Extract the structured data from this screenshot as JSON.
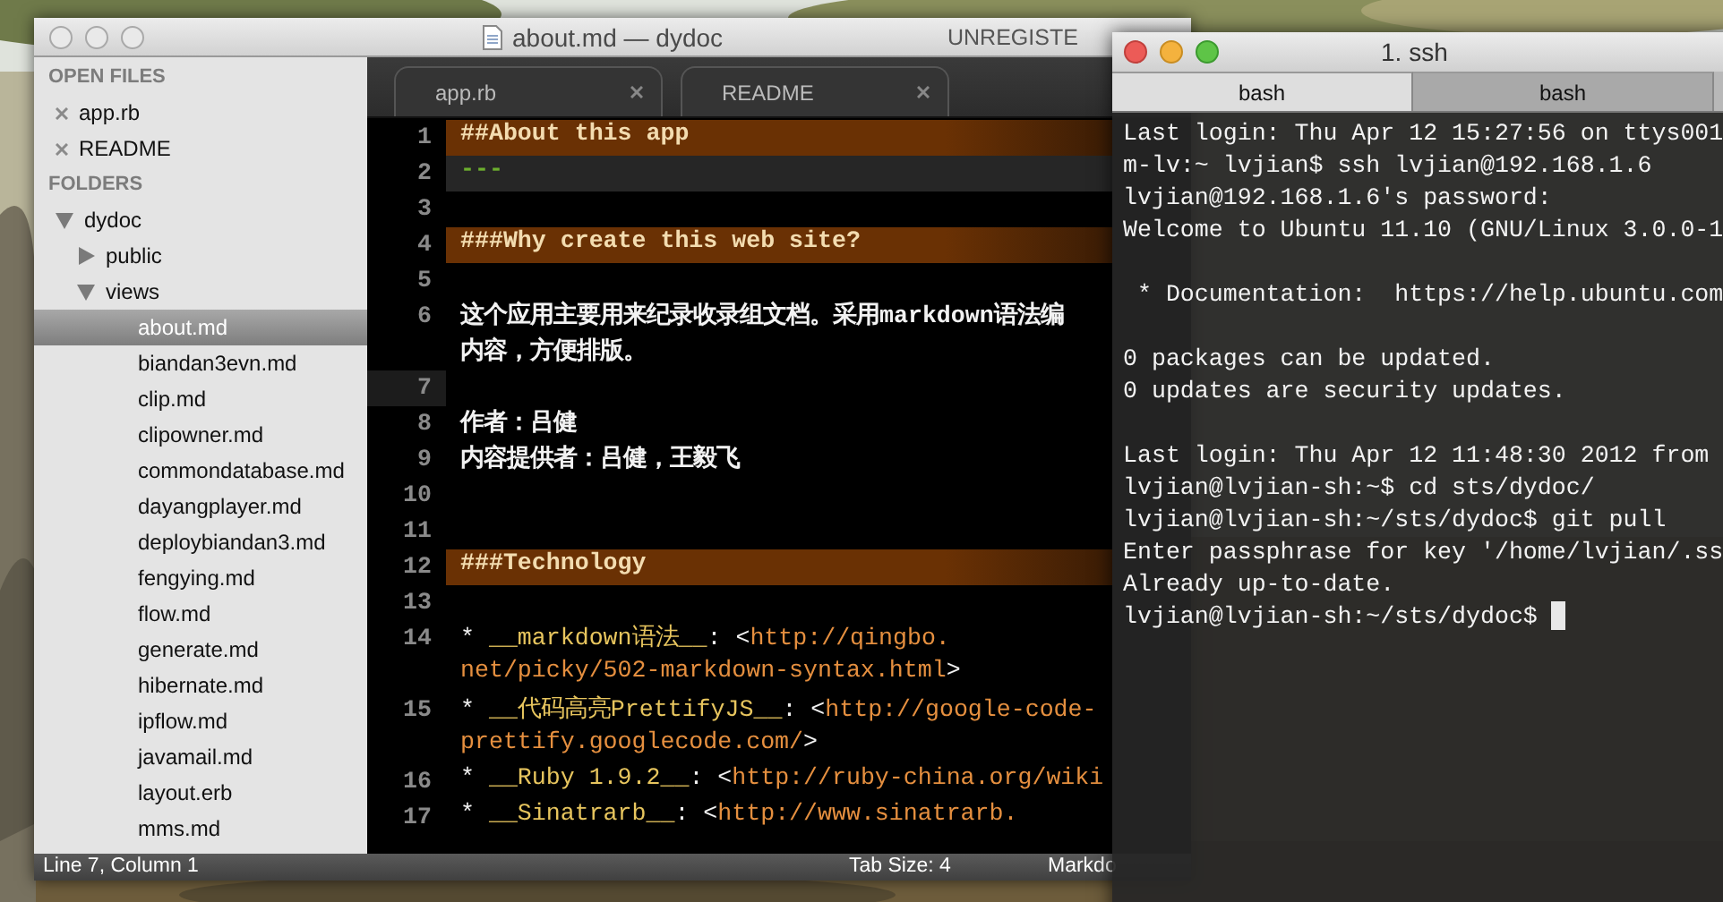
{
  "editor_window": {
    "title": "about.md — dydoc",
    "badge": "UNREGISTE",
    "sidebar": {
      "open_files_header": "OPEN FILES",
      "open_files": [
        {
          "label": "app.rb",
          "selected": false
        },
        {
          "label": "README",
          "selected": false
        }
      ],
      "folders_header": "FOLDERS",
      "tree": [
        {
          "label": "dydoc",
          "kind": "folder",
          "expanded": true,
          "selected": false,
          "children": [
            {
              "label": "public",
              "kind": "folder",
              "expanded": false,
              "selected": false
            },
            {
              "label": "views",
              "kind": "folder",
              "expanded": true,
              "selected": false,
              "children": [
                {
                  "label": "about.md",
                  "kind": "file",
                  "selected": true
                },
                {
                  "label": "biandan3evn.md",
                  "kind": "file",
                  "selected": false
                },
                {
                  "label": "clip.md",
                  "kind": "file",
                  "selected": false
                },
                {
                  "label": "clipowner.md",
                  "kind": "file",
                  "selected": false
                },
                {
                  "label": "commondatabase.md",
                  "kind": "file",
                  "selected": false
                },
                {
                  "label": "dayangplayer.md",
                  "kind": "file",
                  "selected": false
                },
                {
                  "label": "deploybiandan3.md",
                  "kind": "file",
                  "selected": false
                },
                {
                  "label": "fengying.md",
                  "kind": "file",
                  "selected": false
                },
                {
                  "label": "flow.md",
                  "kind": "file",
                  "selected": false
                },
                {
                  "label": "generate.md",
                  "kind": "file",
                  "selected": false
                },
                {
                  "label": "hibernate.md",
                  "kind": "file",
                  "selected": false
                },
                {
                  "label": "ipflow.md",
                  "kind": "file",
                  "selected": false
                },
                {
                  "label": "javamail.md",
                  "kind": "file",
                  "selected": false
                },
                {
                  "label": "layout.erb",
                  "kind": "file",
                  "selected": false
                },
                {
                  "label": "mms.md",
                  "kind": "file",
                  "selected": false
                }
              ]
            }
          ]
        }
      ]
    },
    "tabs": [
      {
        "label": "app.rb",
        "selected": false
      },
      {
        "label": "README",
        "selected": false
      }
    ],
    "lines": [
      {
        "number": "1",
        "kind": "heading",
        "current": false,
        "rows": [
          "##About this app"
        ]
      },
      {
        "number": "2",
        "kind": "rule",
        "current": false,
        "rows": [
          "---"
        ]
      },
      {
        "number": "3",
        "kind": "plain",
        "current": false
      },
      {
        "number": "4",
        "kind": "heading",
        "current": false,
        "rows": [
          "###Why create this web site?"
        ]
      },
      {
        "number": "5",
        "kind": "plain",
        "current": false
      },
      {
        "number": "6",
        "kind": "plain",
        "current": false,
        "rows": [
          "这个应用主要用来纪录收录组文档。采用markdown语法编",
          "内容，方便排版。"
        ]
      },
      {
        "number": "7",
        "kind": "plain",
        "current": true
      },
      {
        "number": "8",
        "kind": "plain",
        "current": false,
        "rows": [
          "作者：吕健"
        ]
      },
      {
        "number": "9",
        "kind": "plain",
        "current": false,
        "rows": [
          "内容提供者：吕健，王毅飞"
        ]
      },
      {
        "number": "10",
        "kind": "plain",
        "current": false
      },
      {
        "number": "11",
        "kind": "plain",
        "current": false
      },
      {
        "number": "12",
        "kind": "heading",
        "current": false,
        "rows": [
          "###Technology"
        ]
      },
      {
        "number": "13",
        "kind": "plain",
        "current": false
      },
      {
        "number": "14",
        "kind": "list",
        "current": false,
        "rows": [
          "* **__markdown语法__**: <*http://qingbo.*",
          "*net/picky/502-markdown-syntax.html*>"
        ]
      },
      {
        "number": "15",
        "kind": "list",
        "current": false,
        "rows": [
          "* **__代码高亮PrettifyJS__**: <*http://google-code-*",
          "*prettify.googlecode.com/*>"
        ]
      },
      {
        "number": "16",
        "kind": "list",
        "current": false,
        "rows": [
          "* **__Ruby 1.9.2__**: <*http://ruby-china.org/wiki*"
        ]
      },
      {
        "number": "17",
        "kind": "list",
        "current": false,
        "rows": [
          "* **__Sinatrarb__**: <*http://www.sinatrarb.*"
        ]
      }
    ],
    "status_bar": {
      "position": "Line 7, Column 1",
      "tab_size": "Tab Size: 4",
      "syntax": "Markdo"
    }
  },
  "terminal_window": {
    "title": "1. ssh",
    "tabs": [
      {
        "label": "bash",
        "selected": true
      },
      {
        "label": "bash",
        "selected": false
      }
    ],
    "blocks": [
      [
        "Last login: Thu Apr 12 15:27:56 on ttys001",
        "m-lv:~ lvjian$ ssh lvjian@192.168.1.6",
        "lvjian@192.168.1.6's password:",
        "Welcome to Ubuntu 11.10 (GNU/Linux 3.0.0-1"
      ],
      [
        " * Documentation:  https://help.ubuntu.com"
      ],
      [
        "0 packages can be updated.",
        "0 updates are security updates."
      ],
      [
        "Last login: Thu Apr 12 11:48:30 2012 from",
        "lvjian@lvjian-sh:~$ cd sts/dydoc/",
        "lvjian@lvjian-sh:~/sts/dydoc$ git pull",
        "Enter passphrase for key '/home/lvjian/.ss",
        "Already up-to-date."
      ]
    ],
    "prompt": "lvjian@lvjian-sh:~/sts/dydoc$"
  }
}
